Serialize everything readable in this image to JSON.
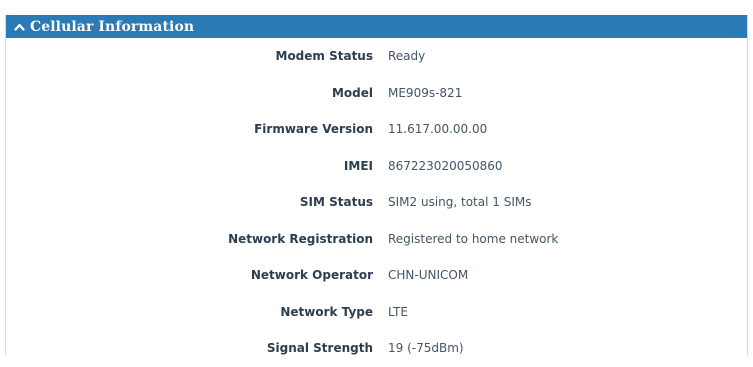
{
  "section": {
    "title": "Cellular Information",
    "icon": "chevron-up-icon",
    "header_color": "#2a7ab5"
  },
  "rows": [
    {
      "label": "Modem Status",
      "value": "Ready"
    },
    {
      "label": "Model",
      "value": "ME909s-821"
    },
    {
      "label": "Firmware Version",
      "value": "11.617.00.00.00"
    },
    {
      "label": "IMEI",
      "value": "867223020050860"
    },
    {
      "label": "SIM Status",
      "value": "SIM2 using, total 1 SIMs"
    },
    {
      "label": "Network Registration",
      "value": "Registered to home network"
    },
    {
      "label": "Network Operator",
      "value": "CHN-UNICOM"
    },
    {
      "label": "Network Type",
      "value": "LTE"
    },
    {
      "label": "Signal Strength",
      "value": "19 (-75dBm)"
    }
  ]
}
